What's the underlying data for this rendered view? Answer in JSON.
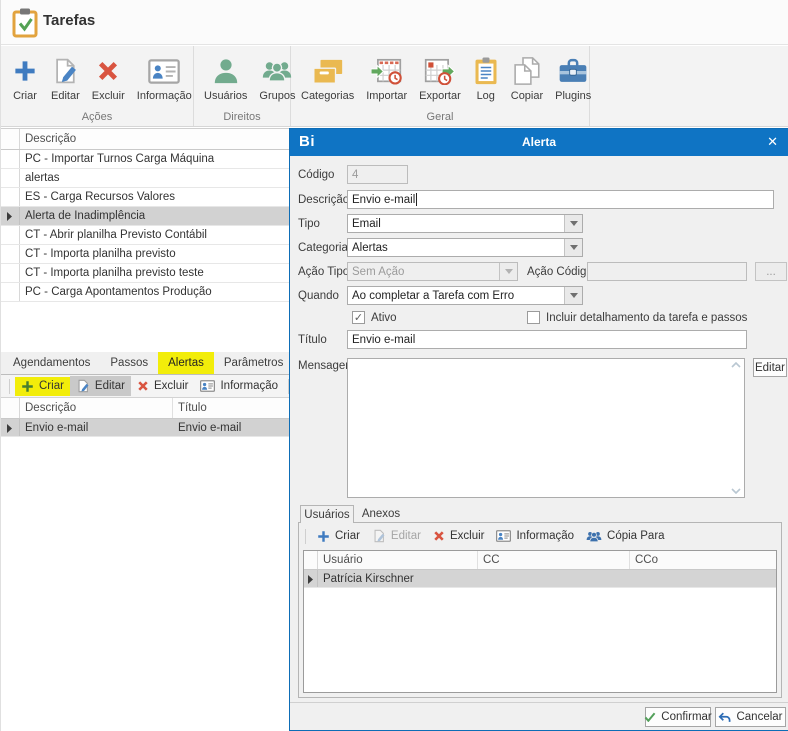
{
  "window": {
    "title": "Tarefas"
  },
  "ribbon": {
    "groups": [
      {
        "label": "Ações",
        "items": [
          {
            "label": "Criar"
          },
          {
            "label": "Editar"
          },
          {
            "label": "Excluir"
          },
          {
            "label": "Informação"
          }
        ]
      },
      {
        "label": "Direitos",
        "items": [
          {
            "label": "Usuários"
          },
          {
            "label": "Grupos"
          }
        ]
      },
      {
        "label": "Geral",
        "items": [
          {
            "label": "Categorias"
          },
          {
            "label": "Importar"
          },
          {
            "label": "Exportar"
          },
          {
            "label": "Log"
          },
          {
            "label": "Copiar"
          },
          {
            "label": "Plugins"
          }
        ]
      }
    ]
  },
  "task_list": {
    "column": "Descrição",
    "rows": [
      "PC - Importar Turnos Carga Máquina",
      "alertas",
      "ES - Carga Recursos Valores",
      "Alerta de Inadimplência",
      "CT - Abrir planilha Previsto Contábil",
      "CT - Importa planilha previsto",
      "CT - Importa planilha previsto teste",
      "PC - Carga Apontamentos Produção"
    ],
    "selected_row": "Alerta de Inadimplência"
  },
  "tabs": {
    "items": [
      "Agendamentos",
      "Passos",
      "Alertas",
      "Parâmetros"
    ],
    "active": "Alertas"
  },
  "alerts_toolbar": {
    "criar": "Criar",
    "editar": "Editar",
    "excluir": "Excluir",
    "informacao": "Informação"
  },
  "alerts_grid": {
    "columns": [
      "Descrição",
      "Título"
    ],
    "rows": [
      {
        "descricao": "Envio e-mail",
        "titulo": "Envio e-mail"
      }
    ],
    "selected_row": "Envio e-mail"
  },
  "dialog": {
    "logo": "Bi",
    "title": "Alerta",
    "close": "✕",
    "fields": {
      "codigo_label": "Código",
      "codigo_value": "4",
      "descricao_label": "Descrição",
      "descricao_value": "Envio e-mail",
      "tipo_label": "Tipo",
      "tipo_value": "Email",
      "categoria_label": "Categoria",
      "categoria_value": "Alertas",
      "acao_tipo_label": "Ação Tipo",
      "acao_tipo_value": "Sem Ação",
      "acao_codigo_label": "Ação Código",
      "acao_codigo_value": "",
      "ellipsis": "...",
      "quando_label": "Quando",
      "quando_value": "Ao completar a Tarefa com Erro",
      "ativo_label": "Ativo",
      "ativo_checked": true,
      "check_glyph": "✓",
      "incluir_label": "Incluir detalhamento da tarefa e passos",
      "incluir_checked": false,
      "titulo_label": "Título",
      "titulo_value": "Envio e-mail",
      "mensagem_label": "Mensagem",
      "mensagem_value": "",
      "editar_button": "Editar"
    },
    "subtabs": {
      "usuarios": "Usuários",
      "anexos": "Anexos",
      "active": "Usuários"
    },
    "users_toolbar": {
      "criar": "Criar",
      "editar": "Editar",
      "excluir": "Excluir",
      "informacao": "Informação",
      "copia_para": "Cópia Para"
    },
    "users_grid": {
      "columns": [
        "Usuário",
        "CC",
        "CCo"
      ],
      "rows": [
        {
          "usuario": "Patrícia Kirschner",
          "cc": "",
          "cco": ""
        }
      ],
      "selected_row": "Patrícia Kirschner"
    },
    "footer": {
      "confirmar": "Confirmar",
      "cancelar": "Cancelar"
    }
  },
  "colors": {
    "accent_blue": "#0f74c4",
    "highlight_yellow": "#f2ed0a",
    "selection_gray": "#d2d2d2",
    "icon_blue": "#3f7bc0",
    "icon_green": "#72ab8e",
    "icon_red": "#d95440",
    "icon_yellow": "#eab951"
  }
}
